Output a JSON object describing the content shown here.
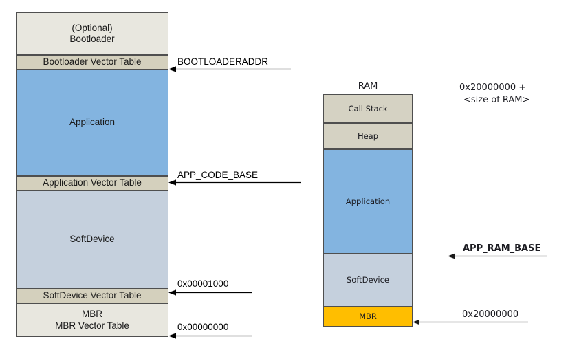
{
  "diagram": {
    "title_ram": "RAM",
    "flash": {
      "name": "flash-memory-layout",
      "blocks": [
        {
          "id": "bootloader",
          "label": "(Optional)\nBootloader",
          "color": "#e8e7df"
        },
        {
          "id": "bootloader-vector-table",
          "label": "Bootloader Vector Table",
          "color": "#d4d0bd"
        },
        {
          "id": "application",
          "label": "Application",
          "color": "#83b4e0"
        },
        {
          "id": "application-vector-table",
          "label": "Application Vector Table",
          "color": "#d4d0bd"
        },
        {
          "id": "softdevice",
          "label": "SoftDevice",
          "color": "#c5d0dd"
        },
        {
          "id": "softdevice-vector-table",
          "label": "SoftDevice Vector Table",
          "color": "#d4d0bd"
        },
        {
          "id": "mbr",
          "label": "MBR\nMBR Vector Table",
          "color": "#e8e7df"
        }
      ],
      "annotations": [
        {
          "id": "bootloaderaddr",
          "text": "BOOTLOADERADDR",
          "bold": false
        },
        {
          "id": "app-code-base",
          "text": "APP_CODE_BASE",
          "bold": false
        },
        {
          "id": "addr-00001000",
          "text": "0x00001000",
          "bold": false
        },
        {
          "id": "addr-00000000",
          "text": "0x00000000",
          "bold": false
        }
      ]
    },
    "ram": {
      "name": "ram-memory-layout",
      "blocks": [
        {
          "id": "call-stack",
          "label": "Call Stack",
          "color": "#d5d2c3"
        },
        {
          "id": "heap",
          "label": "Heap",
          "color": "#d5d2c3"
        },
        {
          "id": "ram-application",
          "label": "Application",
          "color": "#83b4e0"
        },
        {
          "id": "ram-softdevice",
          "label": "SoftDevice",
          "color": "#c5d0dd"
        },
        {
          "id": "ram-mbr",
          "label": "MBR",
          "color": "#ffbe00"
        }
      ],
      "annotations": [
        {
          "id": "ram-top-addr",
          "line1": "0x20000000 +",
          "line2": "<size of RAM>",
          "bold": false
        },
        {
          "id": "app-ram-base",
          "line1": "APP_RAM_BASE",
          "line2": "",
          "bold": true
        },
        {
          "id": "addr-20000000",
          "line1": "0x20000000",
          "line2": "",
          "bold": false
        }
      ]
    }
  }
}
